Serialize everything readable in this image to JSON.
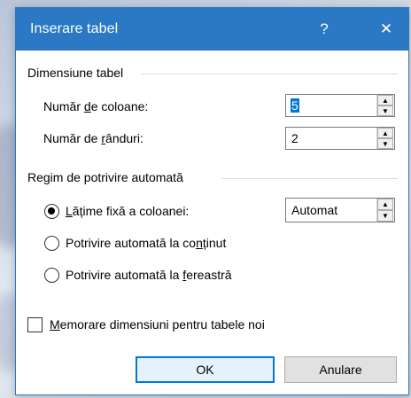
{
  "dialog": {
    "title": "Inserare tabel",
    "help_glyph": "?",
    "close_glyph": "✕"
  },
  "size_group": {
    "label": "Dimensiune tabel",
    "columns_label_pre": "Număr ",
    "columns_label_key": "d",
    "columns_label_post": "e coloane:",
    "columns_value": "5",
    "rows_label_pre": "Număr de ",
    "rows_label_key": "r",
    "rows_label_post": "ânduri:",
    "rows_value": "2"
  },
  "autofit_group": {
    "label": "Regim de potrivire automată",
    "fixed_width_pre": "",
    "fixed_width_key": "L",
    "fixed_width_post": "ățime fixă a coloanei:",
    "fixed_width_value": "Automat",
    "content_pre": "Potrivire automată la co",
    "content_key": "n",
    "content_post": "ținut",
    "window_pre": "Potrivire automată la ",
    "window_key": "f",
    "window_post": "ereastră",
    "selected_option": "fixed_width"
  },
  "remember": {
    "label_pre": "",
    "label_key": "M",
    "label_post": "emorare dimensiuni pentru tabele noi",
    "checked": false
  },
  "buttons": {
    "ok": "OK",
    "cancel": "Anulare"
  },
  "colors": {
    "titlebar": "#2b78c5",
    "selection": "#0078d7"
  },
  "icons": {
    "spin_up": "▲",
    "spin_down": "▼"
  }
}
